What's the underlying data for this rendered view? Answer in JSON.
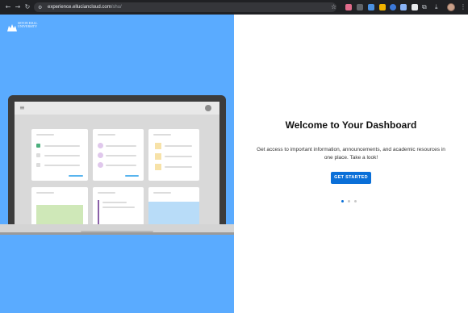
{
  "browser": {
    "url_host": "experience.elluciancloud.com",
    "url_path": "/shu/"
  },
  "brand": {
    "logo_text": "SETON HALL UNIVERSITY"
  },
  "onboarding": {
    "title": "Welcome to Your Dashboard",
    "description": "Get access to important information, announcements, and academic resources in one place. Take a look!",
    "cta_label": "GET STARTED",
    "pages": 3,
    "current_page": 1
  },
  "colors": {
    "left_panel": "#5aabff",
    "accent": "#0a6fd8"
  }
}
